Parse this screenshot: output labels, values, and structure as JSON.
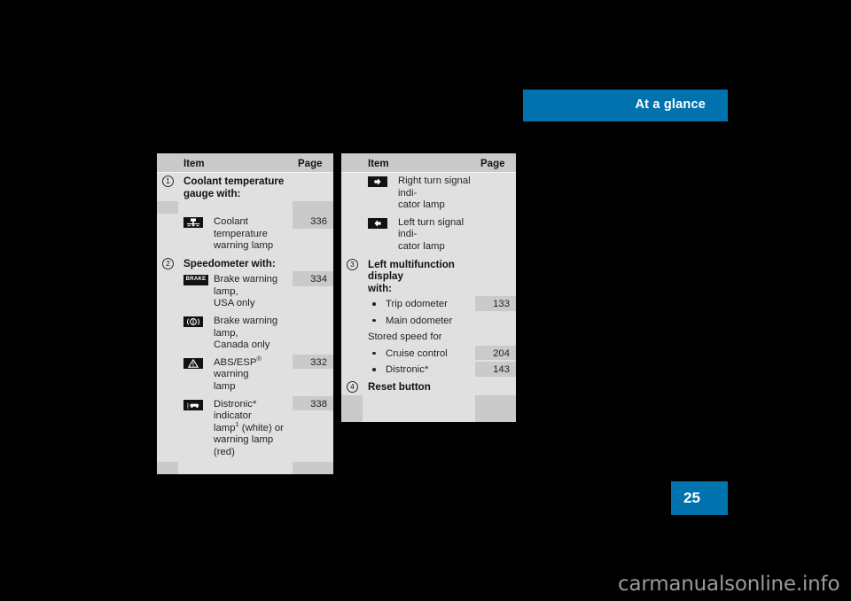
{
  "header": {
    "title": "At a glance",
    "accent_color": "#0073ae"
  },
  "page_tab": {
    "number": "25",
    "accent_color": "#0073ae"
  },
  "watermark": {
    "text": "carmanualsonline.info",
    "color": "#9a9a9a"
  },
  "tables": [
    {
      "name": "left-table",
      "columns": [
        "Item",
        "Page"
      ],
      "rows": [
        {
          "kind": "group",
          "num": "1",
          "title": "Coolant temperature gauge with:",
          "page": ""
        },
        {
          "kind": "icon",
          "icon": "coolant-temperature-warning-lamp-icon",
          "text": "Coolant temperature warning lamp",
          "page": "336"
        },
        {
          "kind": "group",
          "num": "2",
          "title": "Speedometer with:",
          "page": ""
        },
        {
          "kind": "icon",
          "icon": "brake-warning-lamp-usa-icon",
          "text": "Brake warning lamp, USA only",
          "page": "334"
        },
        {
          "kind": "icon",
          "icon": "brake-warning-lamp-canada-icon",
          "text": "Brake warning lamp, Canada only",
          "page": ""
        },
        {
          "kind": "icon",
          "icon": "abs-esp-warning-lamp-icon",
          "text": "ABS/ESP® warning lamp",
          "page": "332"
        },
        {
          "kind": "icon",
          "icon": "distronic-indicator-lamp-icon",
          "text": "Distronic* indicator lamp¹ (white) or warning lamp (red)",
          "page": "338"
        }
      ]
    },
    {
      "name": "right-table",
      "columns": [
        "Item",
        "Page"
      ],
      "rows": [
        {
          "kind": "icon",
          "icon": "right-turn-signal-indicator-lamp-icon",
          "text": "Right turn signal indi-cator lamp",
          "page": ""
        },
        {
          "kind": "icon",
          "icon": "left-turn-signal-indicator-lamp-icon",
          "text": "Left turn signal indi-cator lamp",
          "page": ""
        },
        {
          "kind": "group",
          "num": "3",
          "title": "Left multifunction display with:",
          "page": ""
        },
        {
          "kind": "bullet",
          "text": "Trip odometer",
          "page": "133"
        },
        {
          "kind": "bullet",
          "text": "Main odometer",
          "page": ""
        },
        {
          "kind": "plain",
          "text": "Stored speed for",
          "page": ""
        },
        {
          "kind": "bullet",
          "text": "Cruise control",
          "page": "204"
        },
        {
          "kind": "bullet",
          "text": "Distronic*",
          "page": "143"
        },
        {
          "kind": "group",
          "num": "4",
          "title": "Reset button",
          "page": ""
        }
      ]
    }
  ],
  "left_rows": {
    "r0_title": "Coolant temperature",
    "r0_title2": "gauge with:",
    "r0_num": "1",
    "r1_text": "Coolant temperature",
    "r1_text2": "warning lamp",
    "r1_page": "336",
    "r2_title": "Speedometer with:",
    "r2_num": "2",
    "r3_text": "Brake warning lamp,",
    "r3_text2": "USA only",
    "r3_page": "334",
    "r4_text": "Brake warning lamp,",
    "r4_text2": "Canada only",
    "r5_text_a": "ABS/ESP",
    "r5_text_sup": "®",
    "r5_text_b": " warning",
    "r5_text2": "lamp",
    "r5_page": "332",
    "r6_text_a": "Distronic* indicator",
    "r6_text_b": "lamp",
    "r6_sup": "1",
    "r6_text_c": " (white) or",
    "r6_text2": "warning lamp (red)",
    "r6_page": "338"
  },
  "right_rows": {
    "r0_text": "Right turn signal indi-",
    "r0_text2": "cator lamp",
    "r1_text": "Left turn signal indi-",
    "r1_text2": "cator lamp",
    "r2_num": "3",
    "r2_title": "Left multifunction display",
    "r2_title2": "with:",
    "r3_text": "Trip odometer",
    "r3_page": "133",
    "r4_text": "Main odometer",
    "r5_text": "Stored speed for",
    "r6_text": "Cruise control",
    "r6_page": "204",
    "r7_text": "Distronic*",
    "r7_page": "143",
    "r8_num": "4",
    "r8_title": "Reset button"
  },
  "headers": {
    "item": "Item",
    "page": "Page"
  }
}
